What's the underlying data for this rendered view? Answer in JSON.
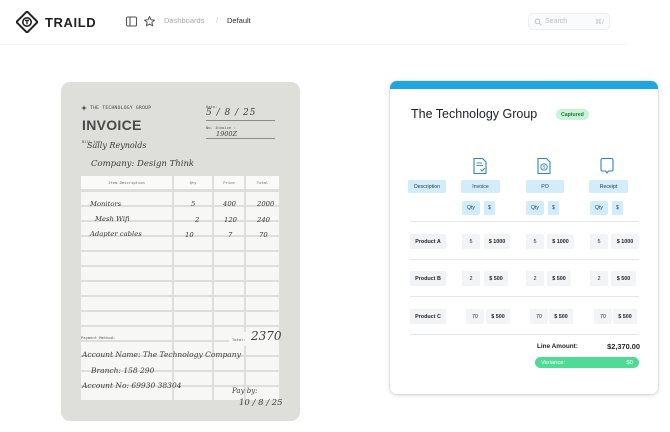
{
  "app": {
    "brand": "TRAILD"
  },
  "breadcrumb": {
    "parent": "Dashboards",
    "separator": "/",
    "current": "Default"
  },
  "search": {
    "placeholder": "Search",
    "shortcut": "⌘/"
  },
  "paper_invoice": {
    "brand": "THE TECHNOLOGY GROUP",
    "title": "INVOICE",
    "date_label": "Date:",
    "date_value": "5 / 8 / 25",
    "invoice_no_label": "No. Invoice :",
    "invoice_no_value": "1900Z",
    "bill_to_label": "Bill to:",
    "bill_to_name": "Sally Reynolds",
    "company": "Company: Design Think",
    "columns": [
      "Item Description",
      "Qty",
      "Price",
      "Total"
    ],
    "rows": [
      {
        "item": "Monitors",
        "qty": "5",
        "price": "400",
        "total": "2000"
      },
      {
        "item": "Mesh Wifi",
        "qty": "2",
        "price": "120",
        "total": "240"
      },
      {
        "item": "Adapter cables",
        "qty": "10",
        "price": "7",
        "total": "70"
      }
    ],
    "payment_label": "Payment Method:",
    "total_label": "Total:",
    "total_value": "2370",
    "account_name": "Account Name: The Technology Company",
    "branch": "Branch: 158 290",
    "account_no": "Account No: 69930 38304",
    "paid_by": "Pay by:",
    "paid_date": "10 / 8 / 25"
  },
  "digital_invoice": {
    "title": "The Technology Group",
    "status": "Captured",
    "description_header": "Description",
    "documents": [
      {
        "label": "Invoice",
        "icon": "invoice-doc-icon"
      },
      {
        "label": "PO",
        "icon": "po-doc-icon"
      },
      {
        "label": "Receipt",
        "icon": "receipt-doc-icon"
      }
    ],
    "subheaders": {
      "qty": "Qty",
      "amount": "$"
    },
    "products": [
      {
        "name": "Product A",
        "invoice": {
          "qty": "5",
          "amount": "$ 1000"
        },
        "po": {
          "qty": "5",
          "amount": "$ 1000"
        },
        "receipt": {
          "qty": "5",
          "amount": "$ 1000"
        }
      },
      {
        "name": "Product B",
        "invoice": {
          "qty": "2",
          "amount": "$ 500"
        },
        "po": {
          "qty": "2",
          "amount": "$ 500"
        },
        "receipt": {
          "qty": "2",
          "amount": "$ 500"
        }
      },
      {
        "name": "Product C",
        "invoice": {
          "qty": "70",
          "amount": "$ 500"
        },
        "po": {
          "qty": "70",
          "amount": "$ 500"
        },
        "receipt": {
          "qty": "70",
          "amount": "$ 500"
        }
      }
    ],
    "line_amount_label": "Line Amount:",
    "line_amount_value": "$2,370.00",
    "variance_label": "Variance:",
    "variance_value": "$0"
  },
  "colors": {
    "accent_bar": "#20a6de",
    "chip_bg": "#d2ecfa",
    "variance": "#4fdb96",
    "captured_bg": "#c9f2d6"
  }
}
